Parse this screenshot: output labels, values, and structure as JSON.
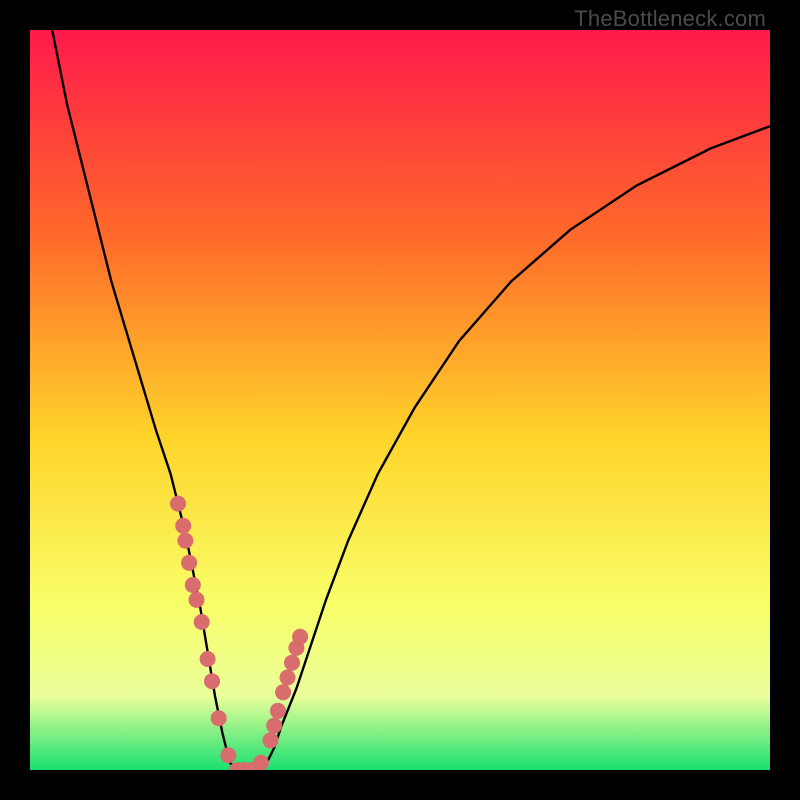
{
  "watermark": "TheBottleneck.com",
  "colors": {
    "top": "#ff1a4b",
    "q1": "#ff6a2a",
    "mid": "#ffd42a",
    "q3": "#f8ff6a",
    "low": "#eaff9a",
    "bottom": "#19e070",
    "curve": "#000000",
    "marker": "#d96c6c",
    "frame": "#000000"
  },
  "chart_data": {
    "type": "line",
    "title": "",
    "xlabel": "",
    "ylabel": "",
    "xlim": [
      0,
      100
    ],
    "ylim": [
      0,
      100
    ],
    "series": [
      {
        "name": "curve",
        "x": [
          3,
          5,
          8,
          11,
          14,
          17,
          19,
          20,
          21,
          22,
          23,
          24,
          25,
          26,
          27,
          28,
          29,
          30,
          31,
          32,
          33,
          34,
          36,
          38,
          40,
          43,
          47,
          52,
          58,
          65,
          73,
          82,
          92,
          100
        ],
        "y": [
          100,
          90,
          78,
          66,
          56,
          46,
          40,
          36,
          32,
          27,
          22,
          16,
          10,
          5,
          1,
          0,
          0,
          0,
          0,
          1,
          3,
          6,
          11,
          17,
          23,
          31,
          40,
          49,
          58,
          66,
          73,
          79,
          84,
          87
        ]
      }
    ],
    "markers": {
      "name": "highlight-points",
      "x": [
        20,
        20.7,
        21,
        21.5,
        22,
        22.5,
        23.2,
        24,
        24.6,
        25.5,
        26.8,
        28,
        29,
        30,
        31.2,
        32.5,
        33,
        33.5,
        34.2,
        34.8,
        35.4,
        36,
        36.5
      ],
      "y": [
        36,
        33,
        31,
        28,
        25,
        23,
        20,
        15,
        12,
        7,
        2,
        0,
        0,
        0,
        1,
        4,
        6,
        8,
        10.5,
        12.5,
        14.5,
        16.5,
        18
      ]
    }
  }
}
